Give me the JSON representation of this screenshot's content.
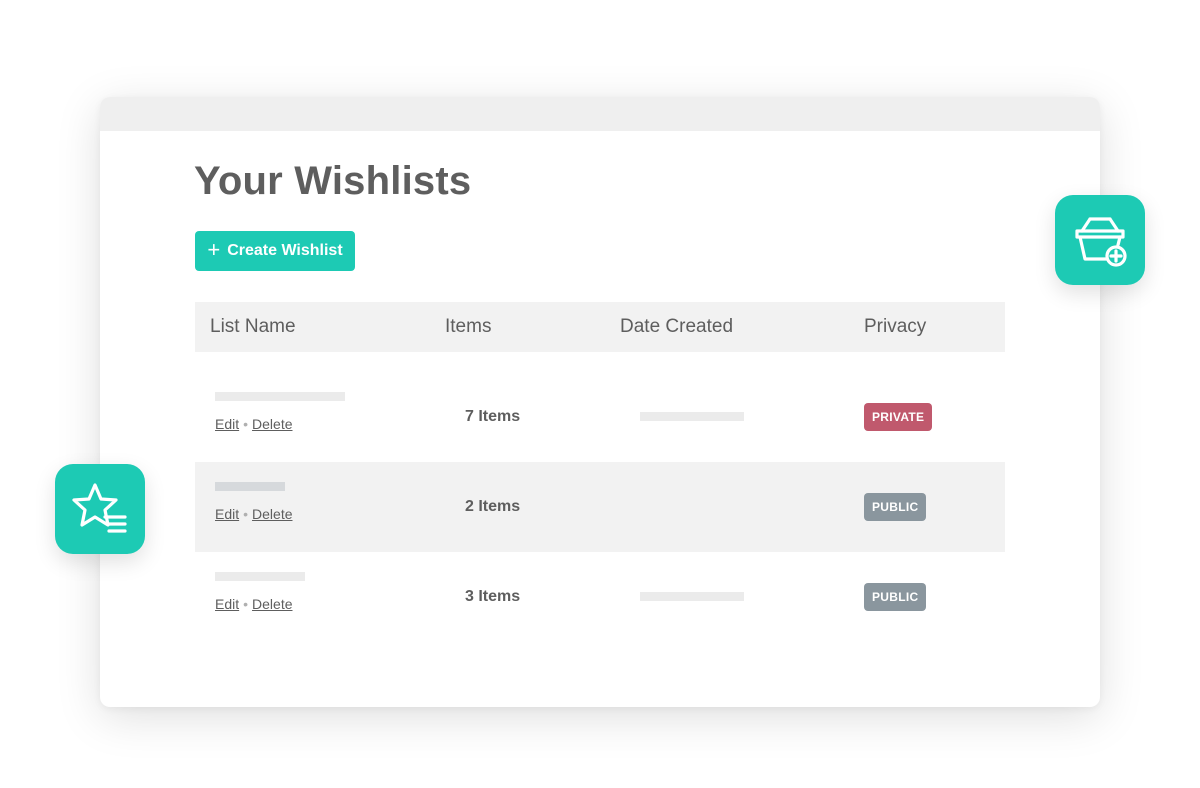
{
  "page": {
    "title": "Your Wishlists",
    "create_button_label": "Create Wishlist"
  },
  "table": {
    "headers": [
      "List Name",
      "Items",
      "Date Created",
      "Privacy"
    ],
    "action_edit": "Edit",
    "action_delete": "Delete",
    "rows": [
      {
        "items": "7 Items",
        "privacy": "PRIVATE",
        "privacy_color": "#c0596d"
      },
      {
        "items": "2 Items",
        "privacy": "PUBLIC",
        "privacy_color": "#8a969e"
      },
      {
        "items": "3 Items",
        "privacy": "PUBLIC",
        "privacy_color": "#8a969e"
      }
    ]
  },
  "colors": {
    "accent": "#1dcab4",
    "private_badge": "#c0596d",
    "public_badge": "#8a969e"
  },
  "icons": {
    "create_button": "plus-icon",
    "floating_right": "basket-add-icon",
    "floating_left": "star-list-icon"
  }
}
